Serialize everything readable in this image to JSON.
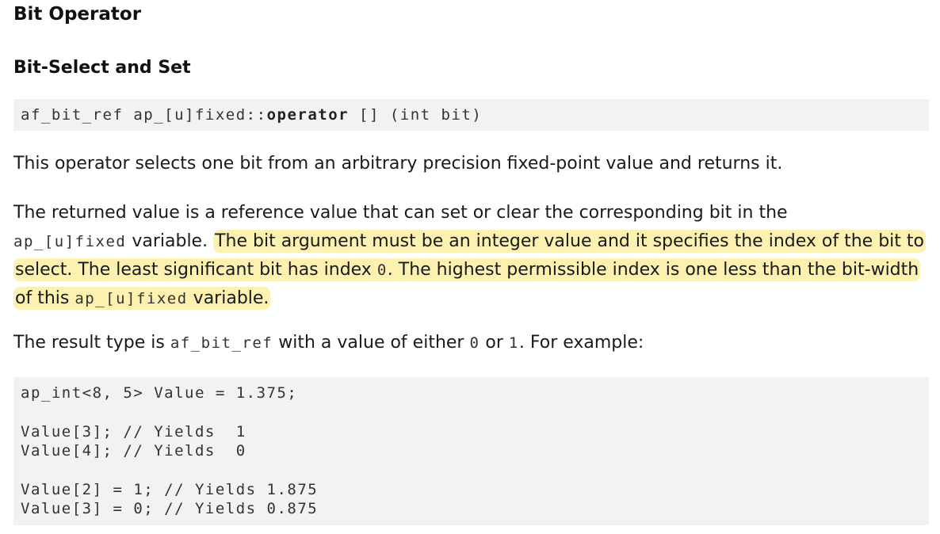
{
  "section_title": "Bit Operator",
  "subsection_title": "Bit-Select and Set",
  "signature": {
    "return_type": "af_bit_ref",
    "class_scope": "ap_[u]fixed::",
    "keyword": "operator",
    "operator_and_args": " [] (int bit)"
  },
  "paragraph1": "This operator selects one bit from an arbitrary precision fixed-point value and returns it.",
  "paragraph2": {
    "text_a": "The returned value is a reference value that can set or clear the corresponding bit in the",
    "code_a": "ap_[u]fixed",
    "text_b": " variable.",
    "highlight_a": "The bit argument must be an integer value and it specifies the index of the bit to select. The least significant bit has index ",
    "code_b": "0",
    "highlight_b": ". The highest permissible index is one less than the bit-width of this ",
    "code_c": "ap_[u]fixed",
    "highlight_c": " variable."
  },
  "paragraph3": {
    "text_a": "The result type is ",
    "code_a": "af_bit_ref",
    "text_b": " with a value of either ",
    "code_b": "0",
    "text_c": " or ",
    "code_c": "1",
    "text_d": ". For example:"
  },
  "example_code": {
    "line1": "ap_int<8, 5> Value = 1.375;",
    "line2": "Value[3]; // Yields  1",
    "line3": "Value[4]; // Yields  0",
    "line4": "Value[2] = 1; // Yields 1.875",
    "line5": "Value[3] = 0; // Yields 0.875"
  },
  "colors": {
    "highlight": "#fcf1b0",
    "code_background": "#f2f2f2"
  }
}
